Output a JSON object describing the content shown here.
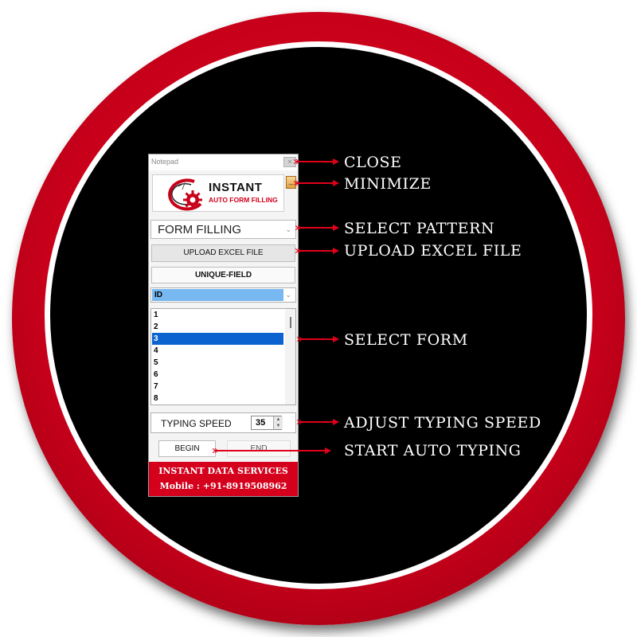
{
  "window": {
    "title": "Notepad",
    "close_glyph": "×",
    "minimize_glyph": "_",
    "logo_title": "INSTANT",
    "logo_subtitle": "AUTO FORM FILLING",
    "pattern_selected": "FORM FILLING",
    "upload_label": "UPLOAD EXCEL FILE",
    "unique_field_label": "UNIQUE-FIELD",
    "id_selected": "ID",
    "forms": [
      "1",
      "2",
      "3",
      "4",
      "5",
      "6",
      "7",
      "8"
    ],
    "selected_form": "3",
    "typing_speed_label": "TYPING SPEED",
    "typing_speed_value": "35",
    "begin_label": "BEGIN",
    "end_label": "END",
    "footer_company": "INSTANT DATA SERVICES",
    "footer_mobile": "Mobile : +91-8919508962"
  },
  "annotations": {
    "close": "CLOSE",
    "minimize": "MINIMIZE",
    "select_pattern": "SELECT PATTERN",
    "upload_excel": "UPLOAD EXCEL FILE",
    "select_form": "SELECT FORM",
    "adjust_speed": "ADJUST TYPING SPEED",
    "start_typing": "START AUTO TYPING"
  },
  "colors": {
    "ring_red": "#d0001b",
    "arrow_red": "#e0001a",
    "selection_blue": "#0a63cf",
    "id_highlight": "#78b8f0",
    "footer_red": "#d4001c"
  },
  "icons": {
    "logo": "gear-icon",
    "dropdown": "chevron-down-icon",
    "close": "close-icon",
    "minimize": "minimize-icon"
  }
}
